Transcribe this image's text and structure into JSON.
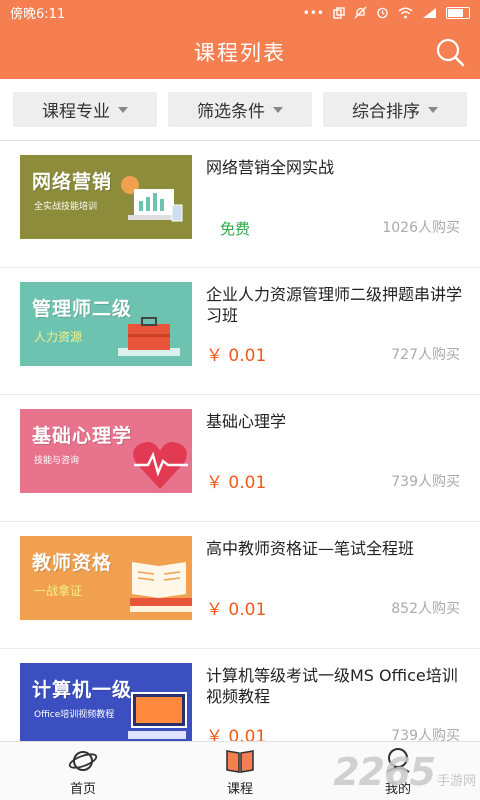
{
  "status_bar": {
    "time": "傍晚6:11",
    "icons": [
      "dots-icon",
      "copy-icon",
      "mute-icon",
      "alarm-icon",
      "wifi-icon",
      "signal-icon",
      "battery-icon"
    ]
  },
  "header": {
    "title": "课程列表",
    "search_icon": "search-icon"
  },
  "filters": [
    {
      "label": "课程专业"
    },
    {
      "label": "筛选条件"
    },
    {
      "label": "综合排序"
    }
  ],
  "courses": [
    {
      "title": "网络营销全网实战",
      "price": "免费",
      "buyers": "1026人购买",
      "thumb_title": "网络营销",
      "thumb_sub": "全实战技能培训",
      "thumb_color": "#8c8c3b"
    },
    {
      "title": "企业人力资源管理师二级押题串讲学习班",
      "price": "￥  0.01",
      "buyers": "727人购买",
      "thumb_title": "管理师二级",
      "thumb_sub": "人力资源",
      "thumb_color": "#6ec3b0"
    },
    {
      "title": "基础心理学",
      "price": "￥  0.01",
      "buyers": "739人购买",
      "thumb_title": "基础心理学",
      "thumb_sub": "技能与咨询",
      "thumb_color": "#e8738c"
    },
    {
      "title": "高中教师资格证—笔试全程班",
      "price": "￥  0.01",
      "buyers": "852人购买",
      "thumb_title": "教师资格",
      "thumb_sub": "一战拿证",
      "thumb_color": "#f0a04e"
    },
    {
      "title": "计算机等级考试一级MS Office培训视频教程",
      "price": "￥  0.01",
      "buyers": "739人购买",
      "thumb_title": "计算机一级",
      "thumb_sub": "Office培训视频教程",
      "thumb_color": "#3b4fc0"
    }
  ],
  "tabs": [
    {
      "label": "首页"
    },
    {
      "label": "课程"
    },
    {
      "label": "我的"
    }
  ],
  "watermark": {
    "number": "2265",
    "text": "手游网"
  }
}
